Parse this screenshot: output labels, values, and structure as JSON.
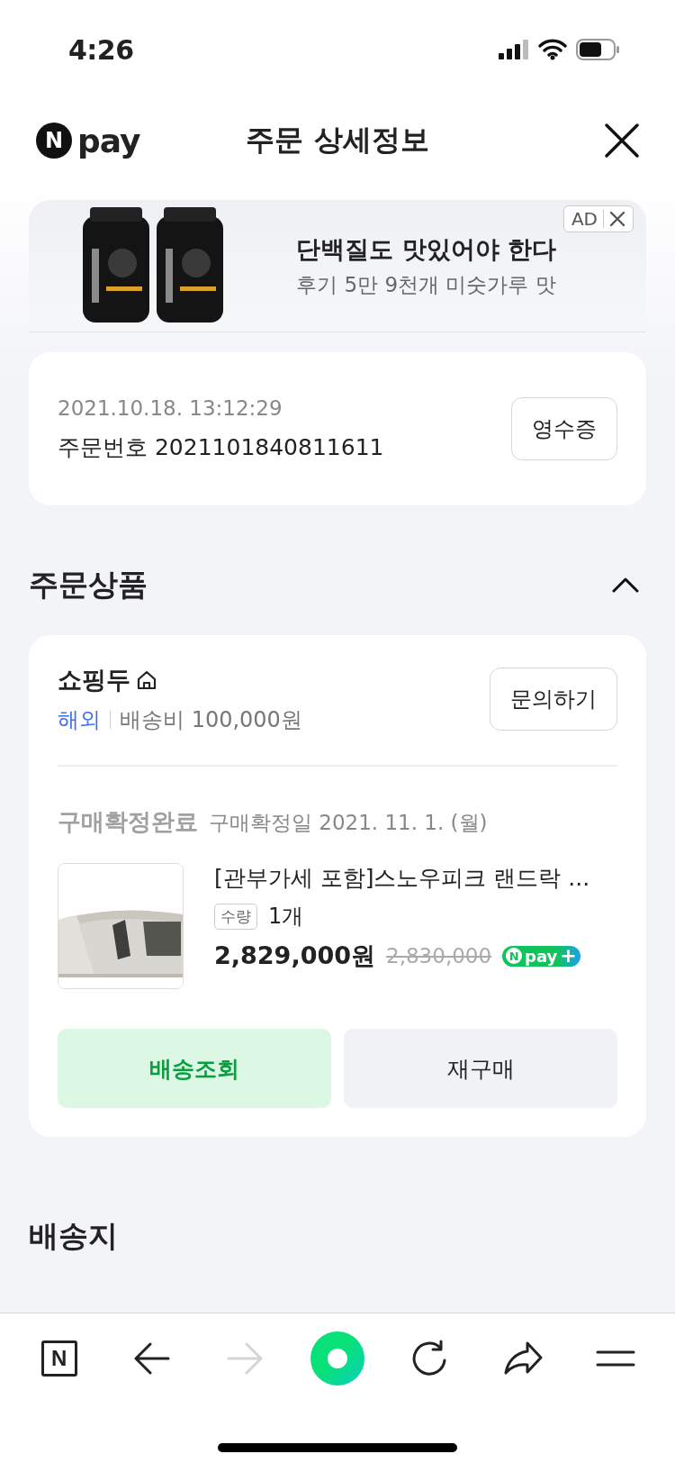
{
  "status_bar": {
    "time": "4:26"
  },
  "header": {
    "logo_mark": "N",
    "logo_text": "pay",
    "title": "주문 상세정보"
  },
  "ad": {
    "badge": "AD",
    "headline": "단백질도 맛있어야 한다",
    "subline": "후기 5만 9천개 미숫가루 맛"
  },
  "order": {
    "datetime": "2021.10.18. 13:12:29",
    "number": "주문번호 2021101840811611",
    "receipt_button": "영수증"
  },
  "order_items_section": {
    "title": "주문상품",
    "expanded": true
  },
  "store": {
    "name": "쇼핑두",
    "origin": "해외",
    "shipping": "배송비 100,000원",
    "inquiry_button": "문의하기"
  },
  "item": {
    "status": "구매확정완료",
    "confirm_date": "구매확정일 2021. 11. 1. (월)",
    "title": "[관부가세 포함]스노우피크 랜드락 ...",
    "qty_label": "수량",
    "qty": "1개",
    "price": "2,829,000원",
    "original_price": "2,830,000",
    "badge": {
      "mark": "N",
      "text": "pay",
      "plus": "+"
    }
  },
  "actions": [
    {
      "label": "배송조회",
      "kind": "primary"
    },
    {
      "label": "재구매",
      "kind": "secondary"
    }
  ],
  "delivery_section": {
    "title": "배송지"
  },
  "nav": [
    {
      "kind": "naver",
      "label": "N",
      "disabled": false
    },
    {
      "kind": "back",
      "disabled": false
    },
    {
      "kind": "forward",
      "disabled": true
    },
    {
      "kind": "green",
      "disabled": false
    },
    {
      "kind": "reload",
      "disabled": false
    },
    {
      "kind": "share",
      "disabled": false
    },
    {
      "kind": "menu",
      "disabled": false
    }
  ]
}
